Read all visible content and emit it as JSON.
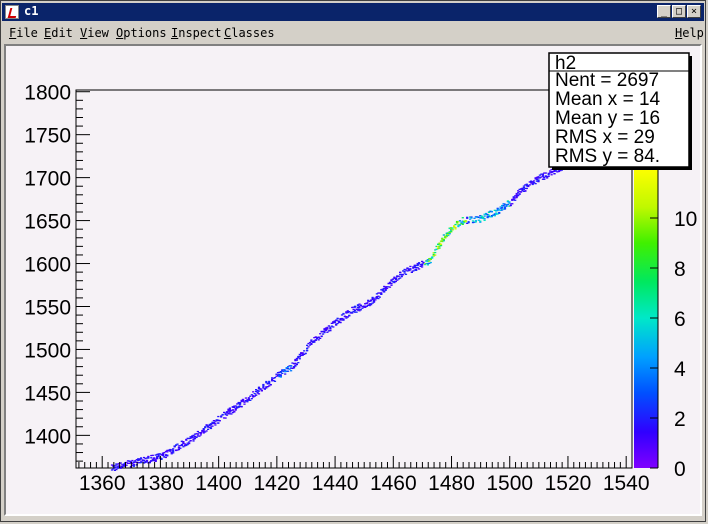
{
  "window": {
    "title": "c1",
    "buttons": {
      "minimize": "_",
      "maximize": "□",
      "close": "×"
    }
  },
  "menu": {
    "items": [
      {
        "label": "File",
        "mnemonic": "F",
        "rest": "ile"
      },
      {
        "label": "Edit",
        "mnemonic": "E",
        "rest": "dit"
      },
      {
        "label": "View",
        "mnemonic": "V",
        "rest": "iew"
      },
      {
        "label": "Options",
        "mnemonic": "O",
        "rest": "ptions"
      },
      {
        "label": "Inspect",
        "mnemonic": "I",
        "rest": "nspect"
      },
      {
        "label": "Classes",
        "mnemonic": "C",
        "rest": "lasses"
      }
    ],
    "help": {
      "label": "Help",
      "mnemonic": "H",
      "rest": "elp"
    }
  },
  "stats": {
    "name": "h2",
    "lines": [
      "Nent = 2697",
      "Mean x =   14",
      "Mean y =   16",
      "RMS x  =  29",
      "RMS y  =  84."
    ]
  },
  "colors": {
    "palette_low": "#8000ff",
    "palette_high": "#ffff00",
    "canvas_bg": "#f6f2f6"
  },
  "chart_data": {
    "type": "heatmap",
    "x_tick_labels": [
      "1360",
      "1380",
      "1400",
      "1420",
      "1440",
      "1460",
      "1480",
      "1500",
      "1520",
      "1540"
    ],
    "y_tick_labels": [
      "1400",
      "1450",
      "1500",
      "1550",
      "1600",
      "1650",
      "1700",
      "1750",
      "1800"
    ],
    "z_tick_labels": [
      "0",
      "2",
      "4",
      "6",
      "8",
      "10"
    ],
    "xlim": [
      1351,
      1542
    ],
    "ylim": [
      1362,
      1802
    ],
    "zlim": [
      0,
      12
    ],
    "grid": false,
    "trend": [
      [
        1362,
        1362
      ],
      [
        1380,
        1376
      ],
      [
        1391,
        1398
      ],
      [
        1400,
        1420
      ],
      [
        1410,
        1444
      ],
      [
        1420,
        1470
      ],
      [
        1425,
        1481
      ],
      [
        1432,
        1510
      ],
      [
        1440,
        1532
      ],
      [
        1445,
        1545
      ],
      [
        1452,
        1556
      ],
      [
        1458,
        1575
      ],
      [
        1463,
        1590
      ],
      [
        1467,
        1596
      ],
      [
        1472,
        1603
      ],
      [
        1475,
        1620
      ],
      [
        1478,
        1636
      ],
      [
        1483,
        1650
      ],
      [
        1490,
        1653
      ],
      [
        1495,
        1661
      ],
      [
        1500,
        1672
      ],
      [
        1503,
        1684
      ],
      [
        1510,
        1700
      ],
      [
        1518,
        1714
      ],
      [
        1526,
        1732
      ],
      [
        1533,
        1748
      ],
      [
        1542,
        1763
      ]
    ]
  }
}
